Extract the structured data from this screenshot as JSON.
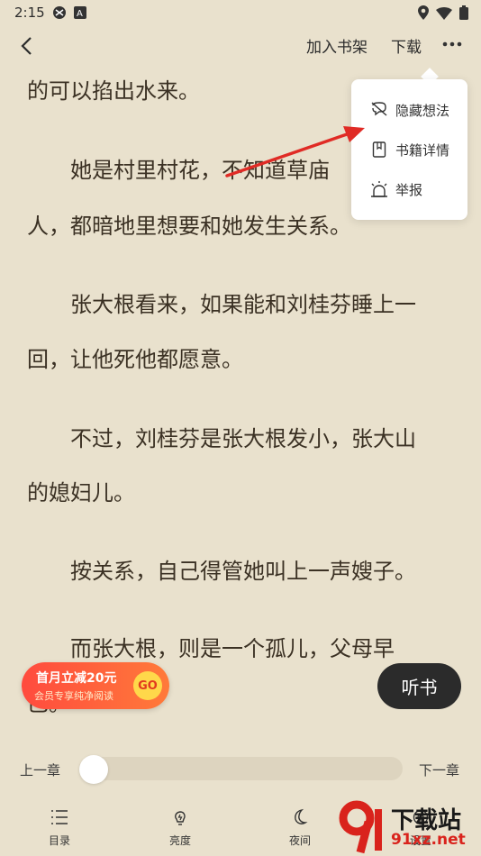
{
  "status_bar": {
    "time": "2:15",
    "left_icons": [
      "globe-icon",
      "a-badge-icon"
    ],
    "right_icons": [
      "location-icon",
      "wifi-icon",
      "battery-icon"
    ]
  },
  "topbar": {
    "back_icon": "chevron-left-icon",
    "add_shelf": "加入书架",
    "download": "下载",
    "more_icon": "more-dots-icon"
  },
  "content": {
    "paragraphs": [
      "的可以掐出水来。",
      "　　她是村里村花，不知道草庙",
      "人，都暗地里想要和她发生关系。",
      "　　张大根看来，如果能和刘桂芬睡上一",
      "回，让他死他都愿意。",
      "　　不过，刘桂芬是张大根发小，张大山",
      "的媳妇儿。",
      "　　按关系，自己得管她叫上一声嫂子。",
      "　　而张大根，则是一个孤儿，父母早",
      "已。"
    ]
  },
  "popup_menu": {
    "items": [
      {
        "label": "隐藏想法",
        "icon": "hide-thought-icon"
      },
      {
        "label": "书籍详情",
        "icon": "book-detail-icon"
      },
      {
        "label": "举报",
        "icon": "report-alarm-icon"
      }
    ]
  },
  "promo": {
    "title": "首月立减20元",
    "subtitle": "会员专享纯净阅读",
    "go": "GO"
  },
  "listen": {
    "label": "听书"
  },
  "chapter_nav": {
    "prev": "上一章",
    "next": "下一章",
    "progress": 0.0
  },
  "bottom_nav": {
    "items": [
      {
        "label": "目录",
        "icon": "list-icon"
      },
      {
        "label": "亮度",
        "icon": "brightness-icon"
      },
      {
        "label": "夜间",
        "icon": "moon-icon"
      },
      {
        "label": "设置",
        "icon": "settings-icon"
      }
    ]
  },
  "watermark": {
    "brand": "下载站",
    "url": "91xz.net"
  },
  "colors": {
    "page_bg": "#e9e1cd",
    "text": "#3b3124",
    "accent_red": "#e02b25",
    "promo_start": "#ff4b3e",
    "promo_end": "#ff7a3a"
  }
}
